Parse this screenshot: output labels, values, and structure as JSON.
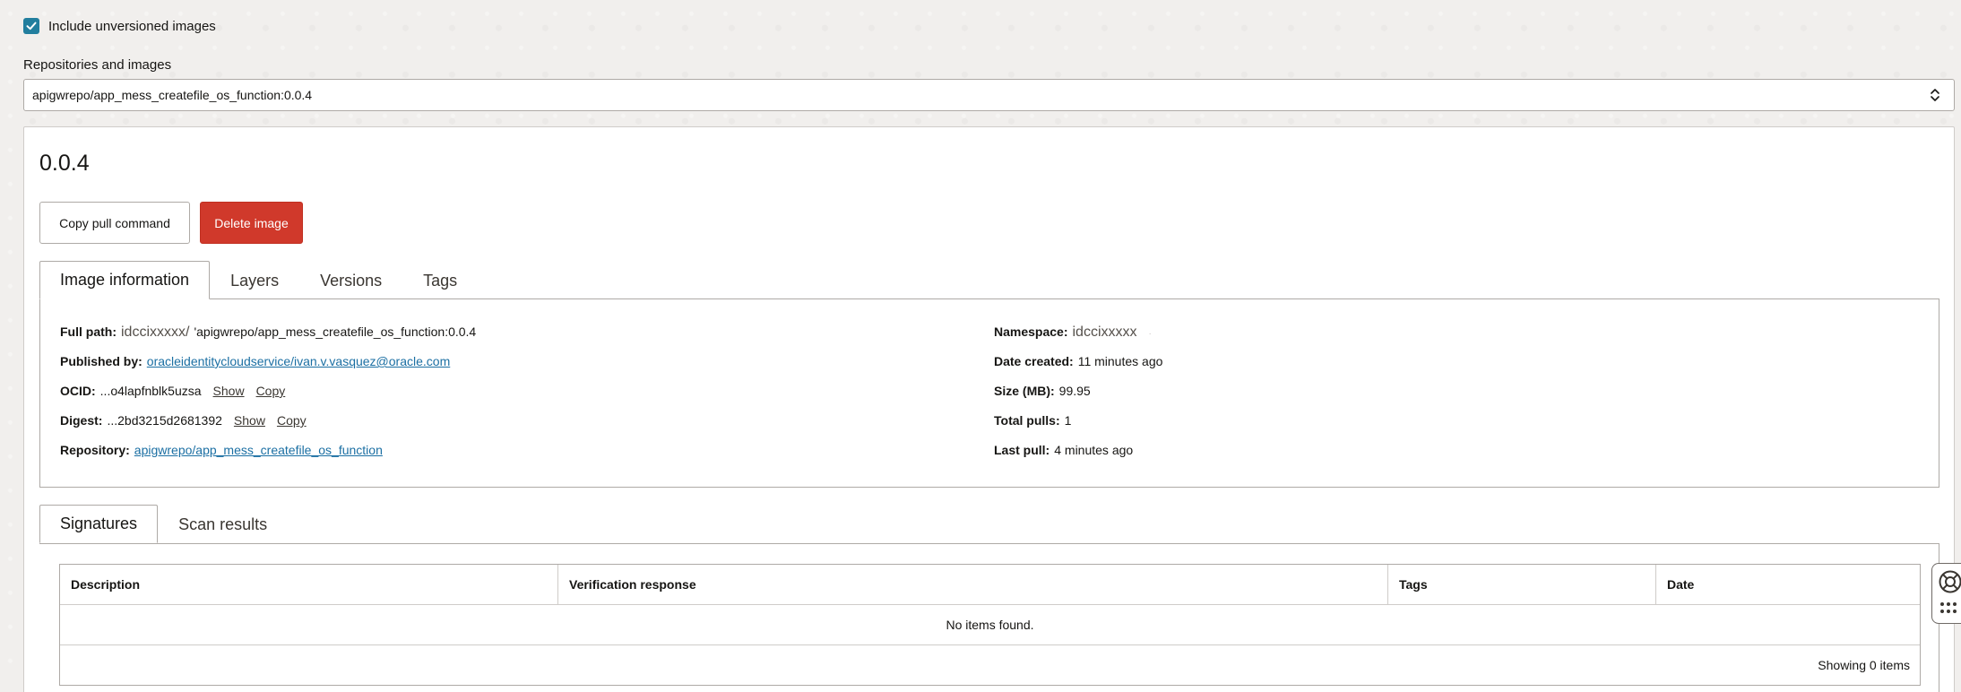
{
  "filter": {
    "include_unversioned_label": "Include unversioned images",
    "include_unversioned_checked": true
  },
  "repo_select": {
    "label": "Repositories and images",
    "value": "apigwrepo/app_mess_createfile_os_function:0.0.4"
  },
  "image": {
    "version": "0.0.4",
    "copy_pull_label": "Copy pull command",
    "delete_label": "Delete image"
  },
  "tabs": [
    {
      "label": "Image information",
      "active": true
    },
    {
      "label": "Layers",
      "active": false
    },
    {
      "label": "Versions",
      "active": false
    },
    {
      "label": "Tags",
      "active": false
    }
  ],
  "info": {
    "full_path_label": "Full path:",
    "full_path_ns": "idccixxxxx/",
    "full_path_value": "'apigwrepo/app_mess_createfile_os_function:0.0.4",
    "published_by_label": "Published by:",
    "published_by_value": "oracleidentitycloudservice/ivan.v.vasquez@oracle.com",
    "ocid_label": "OCID:",
    "ocid_value": "...o4lapfnblk5uzsa",
    "digest_label": "Digest:",
    "digest_value": "...2bd3215d2681392",
    "show_label": "Show",
    "copy_label": "Copy",
    "repository_label": "Repository:",
    "repository_value": "apigwrepo/app_mess_createfile_os_function",
    "namespace_label": "Namespace:",
    "namespace_value": "idccixxxxx",
    "date_created_label": "Date created:",
    "date_created_value": "11 minutes ago",
    "size_label": "Size (MB):",
    "size_value": "99.95",
    "total_pulls_label": "Total pulls:",
    "total_pulls_value": "1",
    "last_pull_label": "Last pull:",
    "last_pull_value": "4 minutes ago"
  },
  "sub_tabs": [
    {
      "label": "Signatures",
      "active": true
    },
    {
      "label": "Scan results",
      "active": false
    }
  ],
  "signatures_table": {
    "columns": [
      "Description",
      "Verification response",
      "Tags",
      "Date"
    ],
    "empty_text": "No items found.",
    "footer_text": "Showing 0 items"
  },
  "colors": {
    "accent": "#227e9e",
    "danger": "#d0392b",
    "link": "#1b6fa3"
  }
}
